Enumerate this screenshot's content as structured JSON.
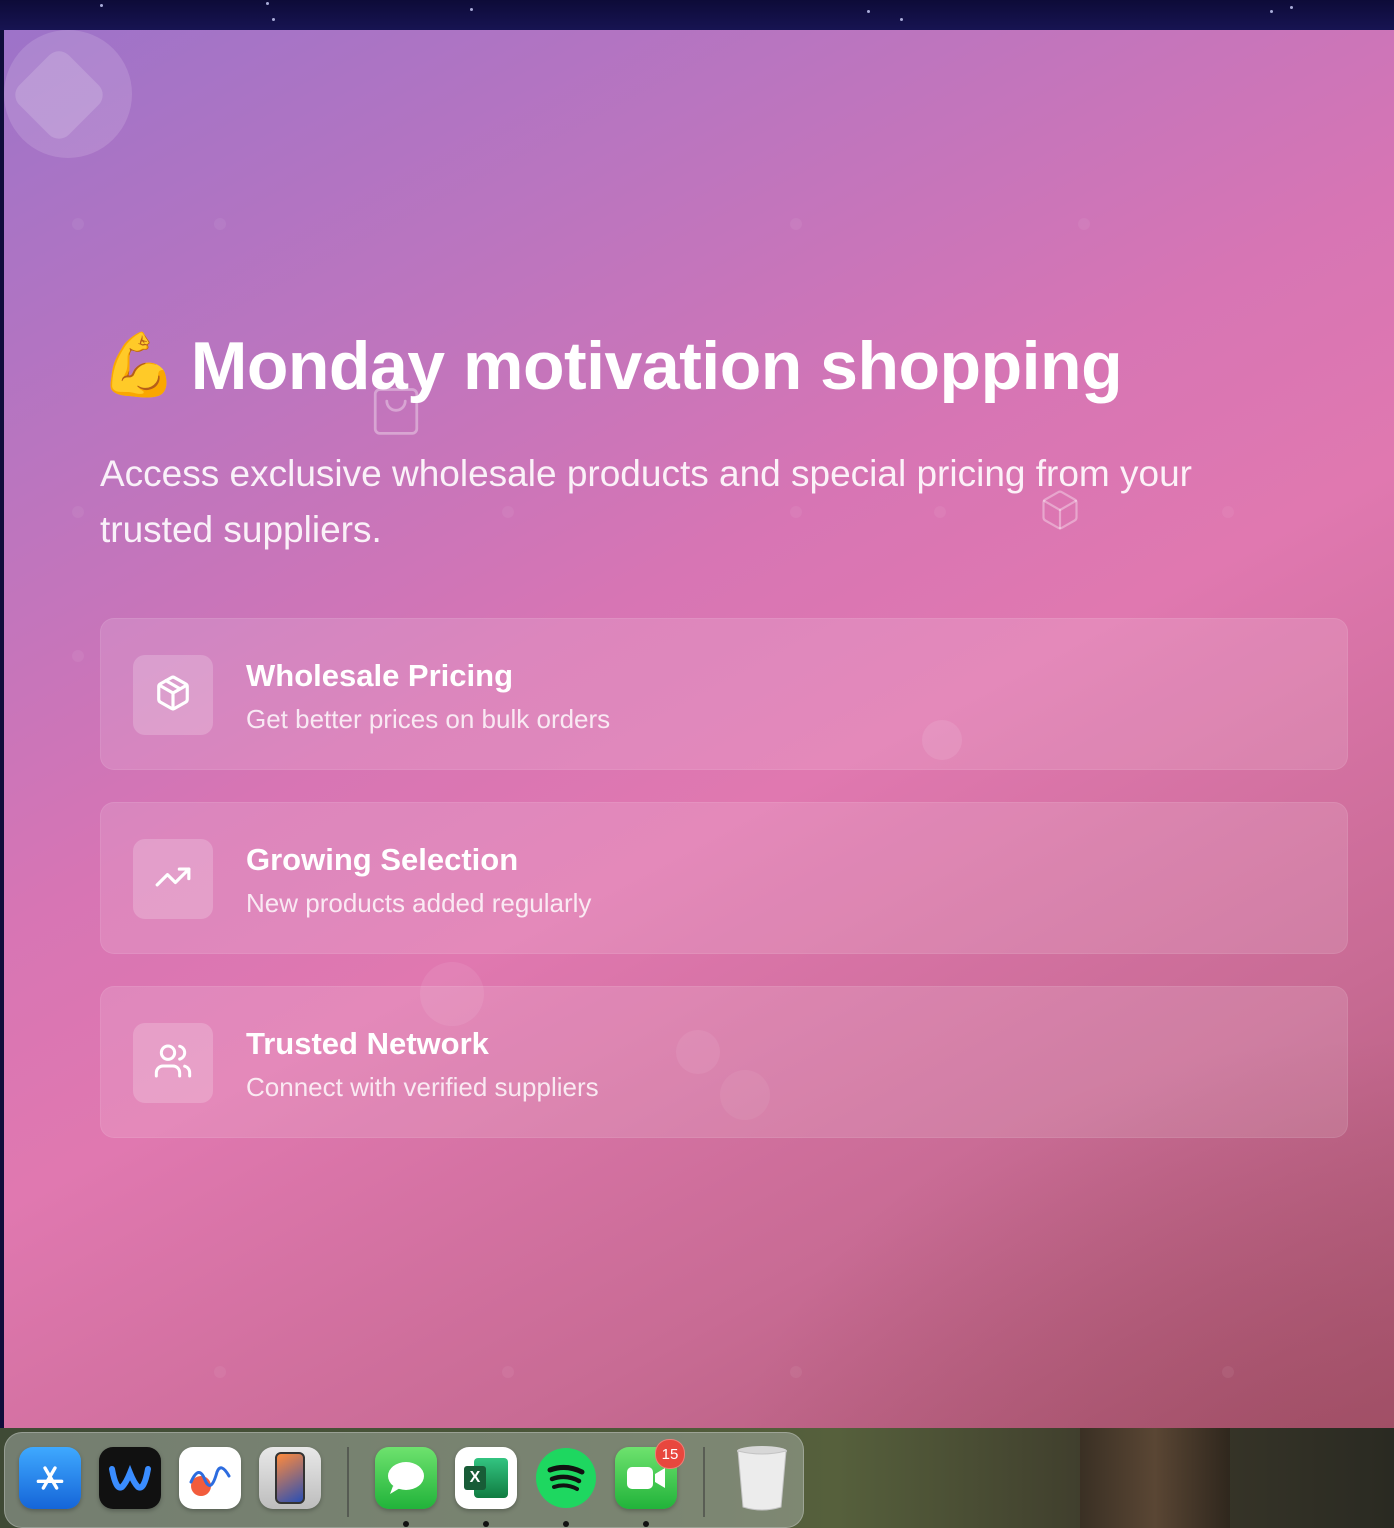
{
  "hero": {
    "emoji": "💪",
    "title": "Monday motivation shopping",
    "subtitle": "Access exclusive wholesale products and special pricing from your trusted suppliers."
  },
  "features": [
    {
      "icon": "package-icon",
      "title": "Wholesale Pricing",
      "description": "Get better prices on bulk orders"
    },
    {
      "icon": "trending-up-icon",
      "title": "Growing Selection",
      "description": "New products added regularly"
    },
    {
      "icon": "users-icon",
      "title": "Trusted Network",
      "description": "Connect with verified suppliers"
    }
  ],
  "dock": {
    "apps": [
      {
        "name": "App Store",
        "icon": "app-store-icon",
        "running": false
      },
      {
        "name": "Webex",
        "icon": "webex-icon",
        "running": false
      },
      {
        "name": "Freeform",
        "icon": "freeform-icon",
        "running": false
      },
      {
        "name": "iPhone Mirroring",
        "icon": "iphone-mirroring-icon",
        "running": false
      },
      {
        "name": "Messages",
        "icon": "messages-icon",
        "running": true
      },
      {
        "name": "Microsoft Excel",
        "icon": "excel-icon",
        "running": true
      },
      {
        "name": "Spotify",
        "icon": "spotify-icon",
        "running": true
      },
      {
        "name": "FaceTime",
        "icon": "facetime-icon",
        "running": true,
        "badge": "15"
      },
      {
        "name": "Trash",
        "icon": "trash-icon",
        "running": false
      }
    ]
  },
  "colors": {
    "gradient_start": "#9d73c9",
    "gradient_mid": "#e078b0",
    "gradient_end": "#a9566f",
    "text": "#ffffff",
    "badge": "#e8473e"
  }
}
